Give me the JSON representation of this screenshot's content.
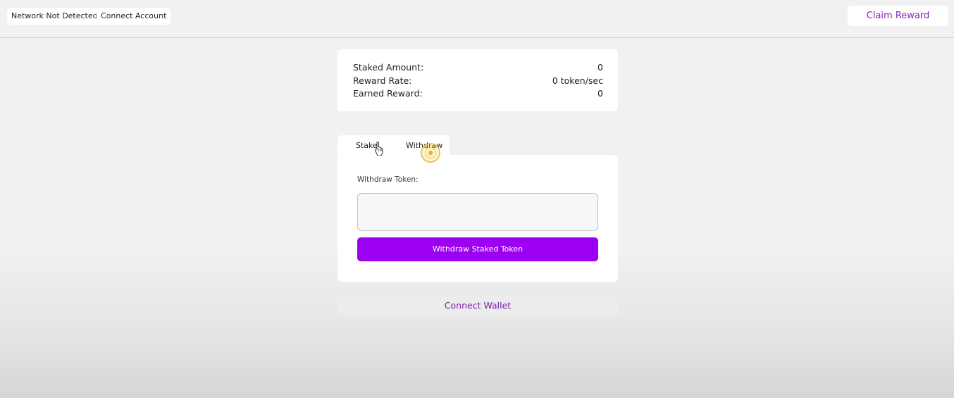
{
  "topbar": {
    "network_status": "Network Not Detected",
    "connect_account": "Connect Account",
    "claim_reward": "Claim Reward"
  },
  "stats": [
    {
      "label": "Staked Amount:",
      "value": "0"
    },
    {
      "label": "Reward Rate:",
      "value": "0 token/sec"
    },
    {
      "label": "Earned Reward:",
      "value": "0"
    }
  ],
  "tabs": {
    "stake": "Stake",
    "withdraw": "Withdraw",
    "active": "withdraw"
  },
  "withdraw": {
    "label": "Withdraw Token:",
    "input_value": "",
    "button": "Withdraw Staked Token"
  },
  "connect_wallet": "Connect Wallet",
  "colors": {
    "primary": "#9b00f0",
    "accent_text": "#8a1fb5",
    "background": "#f1f1f1"
  },
  "icons": {
    "cursor": "hand-pointer-icon",
    "click_indicator": "click-ring-icon"
  }
}
